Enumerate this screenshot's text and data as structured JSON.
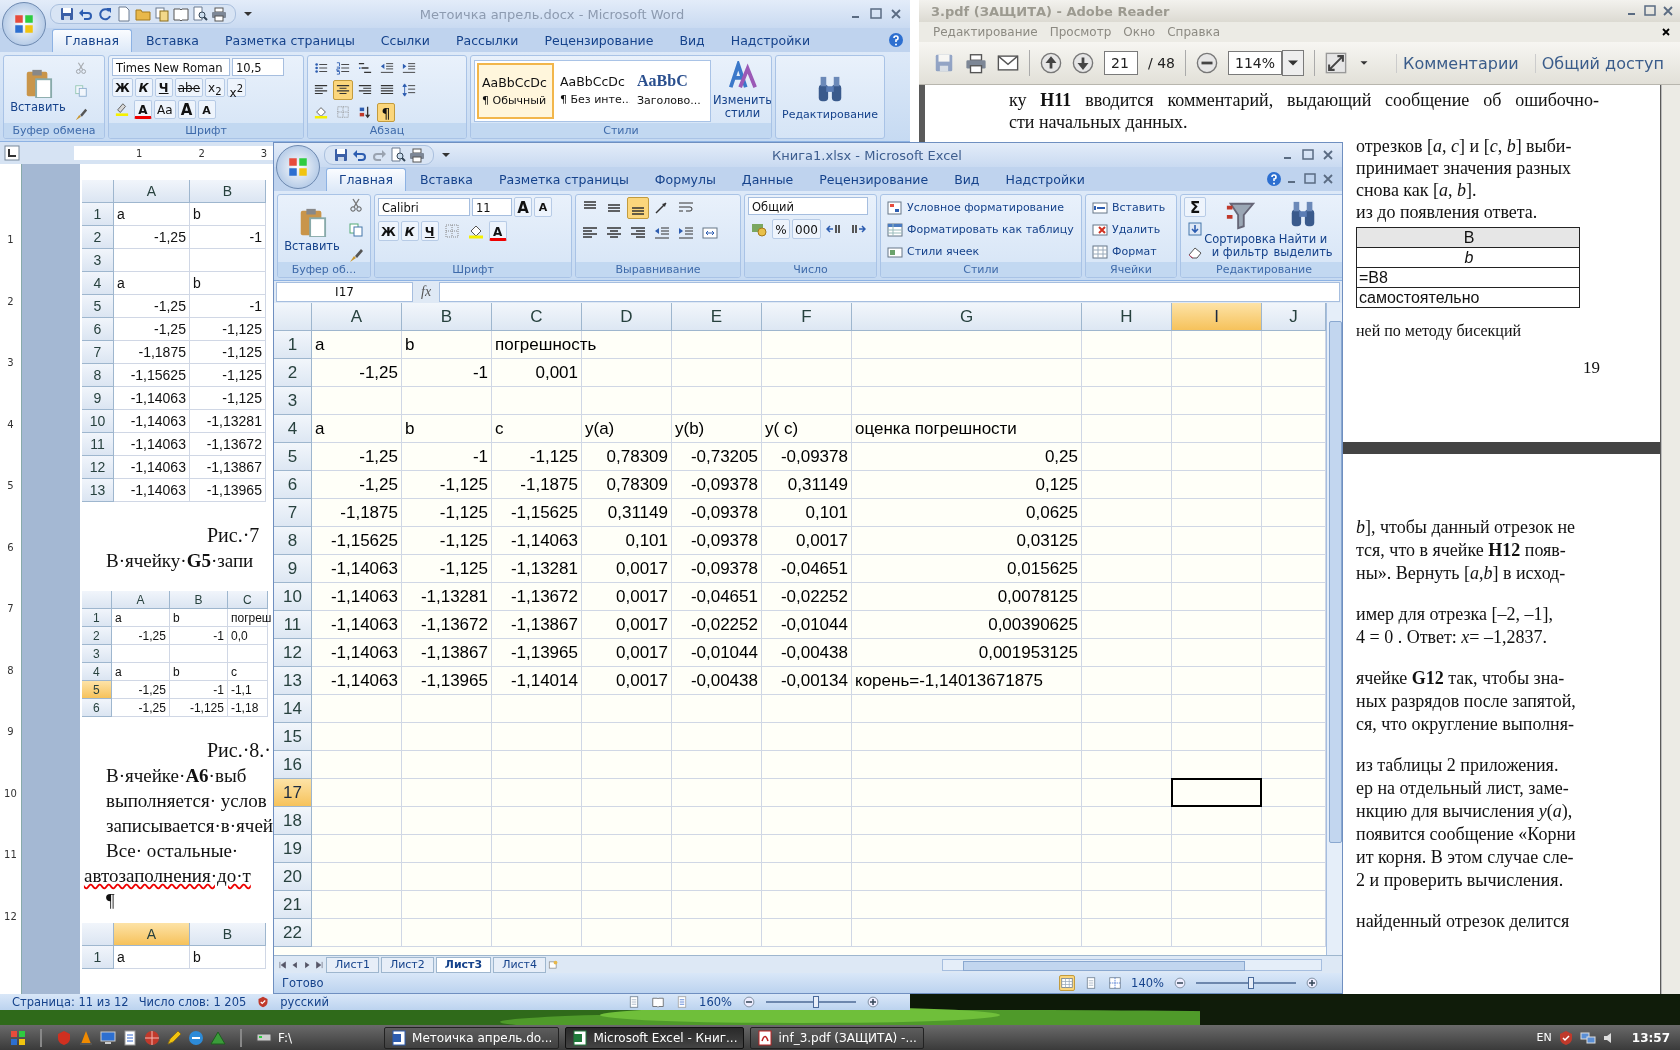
{
  "word": {
    "title": "Метоичка апрель.docx - Microsoft Word",
    "tabs": [
      {
        "label": "Главная",
        "selected": true
      },
      {
        "label": "Вставка",
        "selected": false
      },
      {
        "label": "Разметка страницы",
        "selected": false
      },
      {
        "label": "Ссылки",
        "selected": false
      },
      {
        "label": "Рассылки",
        "selected": false
      },
      {
        "label": "Рецензирование",
        "selected": false
      },
      {
        "label": "Вид",
        "selected": false
      },
      {
        "label": "Надстройки",
        "selected": false
      }
    ],
    "ribbon": {
      "paste": "Вставить",
      "clipboard_label": "Буфер обмена",
      "font_name": "Times New Roman",
      "font_size": "10,5",
      "font_buttons": [
        "Ж",
        "К",
        "Ч",
        "abe",
        "x$_{2}$",
        "x$^{2}$"
      ],
      "case_button": "Aa",
      "grow_font": "A",
      "shrink_font": "A",
      "font_color": "A",
      "font_label": "Шрифт",
      "paragraph_align": [
        {
          "selected": false
        },
        {
          "selected": true
        },
        {
          "selected": false
        },
        {
          "selected": false
        }
      ],
      "pilcrow": {
        "label": "¶",
        "on": true
      },
      "paragraph_label": "Абзац",
      "styles": [
        {
          "sample": "AaBbCcDc",
          "name": "¶ Обычный",
          "selected": true
        },
        {
          "sample": "AaBbCcDc",
          "name": "¶ Без инте...",
          "selected": false
        },
        {
          "sample": "AaBbC",
          "name": "Заголово...",
          "selected": false
        }
      ],
      "change_styles": "Изменить стили",
      "styles_label": "Стили",
      "editing": "Редактирование"
    },
    "ruler": [
      "1",
      "2",
      "3"
    ],
    "vertical_ruler": [
      "1",
      "2",
      "3",
      "4",
      "5",
      "6",
      "7",
      "8",
      "9",
      "10",
      "11",
      "12"
    ],
    "document": [
      {
        "kind": "figure",
        "columns": [
          {
            "label": "A",
            "selected": false
          },
          {
            "label": "B",
            "selected": false
          }
        ],
        "rows": [
          {
            "label": "1",
            "selected": false,
            "cells": [
              {
                "value": "a",
                "kind": "text"
              },
              {
                "value": "b",
                "kind": "text"
              }
            ]
          },
          {
            "label": "2",
            "selected": false,
            "cells": [
              {
                "value": "-1,25",
                "kind": "number"
              },
              {
                "value": "-1",
                "kind": "number"
              }
            ]
          },
          {
            "label": "3",
            "selected": false
          },
          {
            "label": "4",
            "selected": false,
            "cells": [
              {
                "value": "a",
                "kind": "text"
              },
              {
                "value": "b",
                "kind": "text"
              }
            ]
          },
          {
            "label": "5",
            "selected": false,
            "cells": [
              {
                "value": "-1,25",
                "kind": "number"
              },
              {
                "value": "-1",
                "kind": "number"
              }
            ]
          },
          {
            "label": "6",
            "selected": false,
            "cells": [
              {
                "value": "-1,25",
                "kind": "number"
              },
              {
                "value": "-1,125",
                "kind": "number"
              }
            ]
          },
          {
            "label": "7",
            "selected": false,
            "cells": [
              {
                "value": "-1,1875",
                "kind": "number"
              },
              {
                "value": "-1,125",
                "kind": "number"
              }
            ]
          },
          {
            "label": "8",
            "selected": false,
            "cells": [
              {
                "value": "-1,15625",
                "kind": "number"
              },
              {
                "value": "-1,125",
                "kind": "number"
              }
            ]
          },
          {
            "label": "9",
            "selected": false,
            "cells": [
              {
                "value": "-1,14063",
                "kind": "number"
              },
              {
                "value": "-1,125",
                "kind": "number"
              }
            ]
          },
          {
            "label": "10",
            "selected": false,
            "cells": [
              {
                "value": "-1,14063",
                "kind": "number"
              },
              {
                "value": "-1,13281",
                "kind": "number"
              }
            ]
          },
          {
            "label": "11",
            "selected": false,
            "cells": [
              {
                "value": "-1,14063",
                "kind": "number"
              },
              {
                "value": "-1,13672",
                "kind": "number"
              }
            ]
          },
          {
            "label": "12",
            "selected": false,
            "cells": [
              {
                "value": "-1,14063",
                "kind": "number"
              },
              {
                "value": "-1,13867",
                "kind": "number"
              }
            ]
          },
          {
            "label": "13",
            "selected": false,
            "cells": [
              {
                "value": "-1,14063",
                "kind": "number"
              },
              {
                "value": "-1,13965",
                "kind": "number"
              }
            ]
          }
        ]
      },
      {
        "kind": "caption",
        "text": "Рис.·7"
      },
      {
        "kind": "line",
        "text": "В·ячейку·**G5**·запи",
        "misspelled": false
      },
      {
        "kind": "figure",
        "columns": [
          {
            "label": "A",
            "selected": false
          },
          {
            "label": "B",
            "selected": false
          },
          {
            "label": "C",
            "selected": false
          }
        ],
        "rows": [
          {
            "label": "1",
            "selected": false,
            "cells": [
              {
                "value": "a",
                "kind": "text"
              },
              {
                "value": "b",
                "kind": "text"
              },
              {
                "value": "погреш",
                "kind": "text"
              }
            ]
          },
          {
            "label": "2",
            "selected": false,
            "cells": [
              {
                "value": "-1,25",
                "kind": "number"
              },
              {
                "value": "-1",
                "kind": "number"
              },
              {
                "value": "0,0",
                "kind": "text"
              }
            ]
          },
          {
            "label": "3",
            "selected": false
          },
          {
            "label": "4",
            "selected": false,
            "cells": [
              {
                "value": "a",
                "kind": "text"
              },
              {
                "value": "b",
                "kind": "text"
              },
              {
                "value": "c",
                "kind": "text"
              }
            ]
          },
          {
            "label": "5",
            "selected": true,
            "cells": [
              {
                "value": "-1,25",
                "kind": "number"
              },
              {
                "value": "-1",
                "kind": "number"
              },
              {
                "value": "-1,1",
                "kind": "text"
              }
            ]
          },
          {
            "label": "6",
            "selected": false,
            "cells": [
              {
                "value": "-1,25",
                "kind": "number"
              },
              {
                "value": "-1,125",
                "kind": "number"
              },
              {
                "value": "-1,18",
                "kind": "text"
              }
            ]
          }
        ]
      },
      {
        "kind": "caption",
        "text": "Рис.·8.·"
      },
      {
        "kind": "line",
        "text": "В·ячейке·**A6**·выб",
        "misspelled": false
      },
      {
        "kind": "line",
        "text": "выполняется· услов",
        "misspelled": false
      },
      {
        "kind": "line",
        "text": "записывается·в·ячей",
        "misspelled": false
      },
      {
        "kind": "line",
        "text": "Все· остальные·",
        "misspelled": false
      },
      {
        "kind": "line",
        "text": "автозаполнения·до·т",
        "misspelled": true
      },
      {
        "kind": "line",
        "text": "¶",
        "misspelled": false
      },
      {
        "kind": "figure",
        "columns": [
          {
            "label": "A",
            "selected": true
          },
          {
            "label": "B",
            "selected": false
          }
        ],
        "rows": [
          {
            "label": "1",
            "selected": false,
            "cells": [
              {
                "value": "a",
                "kind": "text"
              },
              {
                "value": "b",
                "kind": "text"
              }
            ]
          }
        ]
      }
    ],
    "status_bar": {
      "page": "Страница: 11 из 12",
      "words": "Число слов: 1 205",
      "language": "русский",
      "zoom": "160%",
      "zoom_slider": {
        "level": 0.55
      }
    }
  },
  "reader": {
    "title": "3.pdf (ЗАЩИТА) - Adobe Reader",
    "menu": [
      "Редактирование",
      "Просмотр",
      "Окно",
      "Справка"
    ],
    "page": "21",
    "page_count": "/ 48",
    "zoom": "114%",
    "buttons": [
      "Комментарии",
      "Общий доступ"
    ],
    "top_lines": [
      "ку **H11** вводится комментарий, выдающий сообщение об ошибочно-",
      "сти начальных данных."
    ],
    "side_lines": [
      "отрезков [*a*, *c*] и [*c*, *b*] выби-",
      "принимает значения разных",
      "снова как [*a*, *b*].",
      "из до появления ответа."
    ],
    "table": [
      {
        "text": "B",
        "header": true
      },
      {
        "text": "*b*",
        "header": false
      },
      {
        "text": "=B8",
        "header": false
      },
      {
        "text": "самостоятельно",
        "header": false
      }
    ],
    "caption": "ней по методу бисекций",
    "page_number": "19",
    "next_page": [
      [
        "*b*], чтобы данный отрезок не",
        "тся, что в ячейке **H12** появ-",
        "ны». Вернуть [*a*,*b*] в исход-"
      ],
      [
        "имер для отрезка [–2, –1],",
        "4 = 0 . Ответ: *x*= –1,2837."
      ],
      [
        "ячейке **G12** так, чтобы зна-",
        "ных разрядов после запятой,",
        "ся, что округление выполня-"
      ],
      [
        "из таблицы 2 приложения.",
        "ер на отдельный лист, заме-",
        "нкцию для вычисления *y*(*a*),",
        "появится сообщение «Корни",
        "ит корня. В этом случае сле-",
        "2 и проверить вычисления."
      ],
      [
        "найденный отрезок делится"
      ]
    ]
  },
  "excel": {
    "title": "Книга1.xlsx - Microsoft Excel",
    "tabs": [
      {
        "label": "Главная",
        "selected": true
      },
      {
        "label": "Вставка",
        "selected": false
      },
      {
        "label": "Разметка страницы",
        "selected": false
      },
      {
        "label": "Формулы",
        "selected": false
      },
      {
        "label": "Данные",
        "selected": false
      },
      {
        "label": "Рецензирование",
        "selected": false
      },
      {
        "label": "Вид",
        "selected": false
      },
      {
        "label": "Надстройки",
        "selected": false
      }
    ],
    "ribbon": {
      "paste": "Вставить",
      "clipboard_label": "Буфер об...",
      "font_name": "Calibri",
      "font_size": "11",
      "grow_font": "A",
      "shrink_font": "A",
      "font_buttons": [
        "Ж",
        "К",
        "Ч"
      ],
      "font_color": "A",
      "font_label": "Шрифт",
      "vertical_align": [
        {
          "selected": false
        },
        {
          "selected": false
        },
        {
          "selected": true
        }
      ],
      "alignment_label": "Выравнивание",
      "number_format": "Общий",
      "number_buttons": [
        "%",
        "000"
      ],
      "number_label": "Число",
      "style_items": [
        "Условное форматирование",
        "Форматировать как таблицу",
        "Стили ячеек"
      ],
      "styles_label": "Стили",
      "cell_items": [
        "Вставить",
        "Удалить",
        "Формат"
      ],
      "cells_label": "Ячейки",
      "sum": "Σ",
      "sort": "Сортировка и фильтр",
      "find": "Найти и выделить",
      "editing_label": "Редактирование"
    },
    "name_box": "I17",
    "fx": "fx",
    "grid": {
      "columns": [
        {
          "label": "A",
          "selected": false
        },
        {
          "label": "B",
          "selected": false
        },
        {
          "label": "C",
          "selected": false
        },
        {
          "label": "D",
          "selected": false
        },
        {
          "label": "E",
          "selected": false
        },
        {
          "label": "F",
          "selected": false
        },
        {
          "label": "G",
          "selected": false
        },
        {
          "label": "H",
          "selected": false
        },
        {
          "label": "I",
          "selected": true
        },
        {
          "label": "J",
          "selected": false
        }
      ],
      "rows": [
        {
          "label": "1",
          "selected": false,
          "cells": [
            {
              "value": "a",
              "kind": "text"
            },
            {
              "value": "b",
              "kind": "text"
            },
            {
              "value": "погрешность",
              "kind": "text"
            }
          ]
        },
        {
          "label": "2",
          "selected": false,
          "cells": [
            {
              "value": "-1,25",
              "kind": "number"
            },
            {
              "value": "-1",
              "kind": "number"
            },
            {
              "value": "0,001",
              "kind": "number"
            }
          ]
        },
        {
          "label": "3",
          "selected": false
        },
        {
          "label": "4",
          "selected": false,
          "cells": [
            {
              "value": "a",
              "kind": "text"
            },
            {
              "value": "b",
              "kind": "text"
            },
            {
              "value": "c",
              "kind": "text"
            },
            {
              "value": "y(a)",
              "kind": "text"
            },
            {
              "value": "y(b)",
              "kind": "text"
            },
            {
              "value": "y( c)",
              "kind": "text"
            },
            {
              "value": "оценка погрешности",
              "kind": "text"
            }
          ]
        },
        {
          "label": "5",
          "selected": false,
          "cells": [
            {
              "value": "-1,25",
              "kind": "number"
            },
            {
              "value": "-1",
              "kind": "number"
            },
            {
              "value": "-1,125",
              "kind": "number"
            },
            {
              "value": "0,78309",
              "kind": "number"
            },
            {
              "value": "-0,73205",
              "kind": "number"
            },
            {
              "value": "-0,09378",
              "kind": "number"
            },
            {
              "value": "0,25",
              "kind": "number"
            }
          ]
        },
        {
          "label": "6",
          "selected": false,
          "cells": [
            {
              "value": "-1,25",
              "kind": "number"
            },
            {
              "value": "-1,125",
              "kind": "number"
            },
            {
              "value": "-1,1875",
              "kind": "number"
            },
            {
              "value": "0,78309",
              "kind": "number"
            },
            {
              "value": "-0,09378",
              "kind": "number"
            },
            {
              "value": "0,31149",
              "kind": "number"
            },
            {
              "value": "0,125",
              "kind": "number"
            }
          ]
        },
        {
          "label": "7",
          "selected": false,
          "cells": [
            {
              "value": "-1,1875",
              "kind": "number"
            },
            {
              "value": "-1,125",
              "kind": "number"
            },
            {
              "value": "-1,15625",
              "kind": "number"
            },
            {
              "value": "0,31149",
              "kind": "number"
            },
            {
              "value": "-0,09378",
              "kind": "number"
            },
            {
              "value": "0,101",
              "kind": "number"
            },
            {
              "value": "0,0625",
              "kind": "number"
            }
          ]
        },
        {
          "label": "8",
          "selected": false,
          "cells": [
            {
              "value": "-1,15625",
              "kind": "number"
            },
            {
              "value": "-1,125",
              "kind": "number"
            },
            {
              "value": "-1,14063",
              "kind": "number"
            },
            {
              "value": "0,101",
              "kind": "number"
            },
            {
              "value": "-0,09378",
              "kind": "number"
            },
            {
              "value": "0,0017",
              "kind": "number"
            },
            {
              "value": "0,03125",
              "kind": "number"
            }
          ]
        },
        {
          "label": "9",
          "selected": false,
          "cells": [
            {
              "value": "-1,14063",
              "kind": "number"
            },
            {
              "value": "-1,125",
              "kind": "number"
            },
            {
              "value": "-1,13281",
              "kind": "number"
            },
            {
              "value": "0,0017",
              "kind": "number"
            },
            {
              "value": "-0,09378",
              "kind": "number"
            },
            {
              "value": "-0,04651",
              "kind": "number"
            },
            {
              "value": "0,015625",
              "kind": "number"
            }
          ]
        },
        {
          "label": "10",
          "selected": false,
          "cells": [
            {
              "value": "-1,14063",
              "kind": "number"
            },
            {
              "value": "-1,13281",
              "kind": "number"
            },
            {
              "value": "-1,13672",
              "kind": "number"
            },
            {
              "value": "0,0017",
              "kind": "number"
            },
            {
              "value": "-0,04651",
              "kind": "number"
            },
            {
              "value": "-0,02252",
              "kind": "number"
            },
            {
              "value": "0,0078125",
              "kind": "number"
            }
          ]
        },
        {
          "label": "11",
          "selected": false,
          "cells": [
            {
              "value": "-1,14063",
              "kind": "number"
            },
            {
              "value": "-1,13672",
              "kind": "number"
            },
            {
              "value": "-1,13867",
              "kind": "number"
            },
            {
              "value": "0,0017",
              "kind": "number"
            },
            {
              "value": "-0,02252",
              "kind": "number"
            },
            {
              "value": "-0,01044",
              "kind": "number"
            },
            {
              "value": "0,00390625",
              "kind": "number"
            }
          ]
        },
        {
          "label": "12",
          "selected": false,
          "cells": [
            {
              "value": "-1,14063",
              "kind": "number"
            },
            {
              "value": "-1,13867",
              "kind": "number"
            },
            {
              "value": "-1,13965",
              "kind": "number"
            },
            {
              "value": "0,0017",
              "kind": "number"
            },
            {
              "value": "-0,01044",
              "kind": "number"
            },
            {
              "value": "-0,00438",
              "kind": "number"
            },
            {
              "value": "0,001953125",
              "kind": "number"
            }
          ]
        },
        {
          "label": "13",
          "selected": false,
          "cells": [
            {
              "value": "-1,14063",
              "kind": "number"
            },
            {
              "value": "-1,13965",
              "kind": "number"
            },
            {
              "value": "-1,14014",
              "kind": "number"
            },
            {
              "value": "0,0017",
              "kind": "number"
            },
            {
              "value": "-0,00438",
              "kind": "number"
            },
            {
              "value": "-0,00134",
              "kind": "number"
            },
            {
              "value": "корень=-1,14013671875",
              "kind": "text"
            }
          ]
        },
        {
          "label": "14",
          "selected": false
        },
        {
          "label": "15",
          "selected": false
        },
        {
          "label": "16",
          "selected": false
        },
        {
          "label": "17",
          "selected": true
        },
        {
          "label": "18",
          "selected": false
        },
        {
          "label": "19",
          "selected": false
        },
        {
          "label": "20",
          "selected": false
        },
        {
          "label": "21",
          "selected": false
        },
        {
          "label": "22",
          "selected": false
        }
      ]
    },
    "sheets": [
      {
        "label": "Лист1",
        "selected": false
      },
      {
        "label": "Лист2",
        "selected": false
      },
      {
        "label": "Лист3",
        "selected": true
      },
      {
        "label": "Лист4",
        "selected": false
      }
    ],
    "status": "Готово",
    "zoom": "140%",
    "zoom_slider": {
      "level": 0.55
    }
  },
  "taskbar": {
    "address": "F:\\",
    "tasks": [
      {
        "label": "Метоичка апрель.do...",
        "selected": false
      },
      {
        "label": "Microsoft Excel - Книг...",
        "selected": true
      },
      {
        "label": "inf_3.pdf (ЗАЩИТА) -...",
        "selected": false
      }
    ],
    "language": "EN",
    "clock": "13:57"
  }
}
